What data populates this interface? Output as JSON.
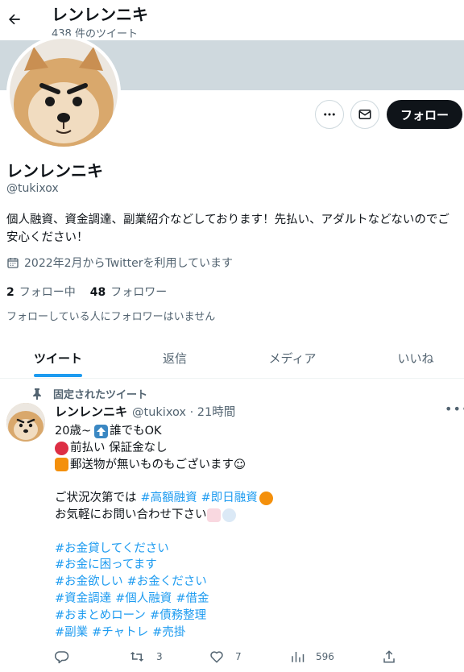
{
  "header": {
    "title": "レンレンニキ",
    "tweet_count": "438 件のツイート"
  },
  "profile": {
    "name": "レンレンニキ",
    "handle": "@tukixox",
    "bio": "個人融資、資金調達、副業紹介などしております！先払い、アダルトなどないのでご安心ください！",
    "joined": "2022年2月からTwitterを利用しています",
    "following_count": "2",
    "following_label": "フォロー中",
    "followers_count": "48",
    "followers_label": "フォロワー",
    "no_known_followers": "フォローしている人にフォロワーはいません",
    "follow_button": "フォロー"
  },
  "tabs": [
    "ツイート",
    "返信",
    "メディア",
    "いいね"
  ],
  "tweet": {
    "pinned_label": "固定されたツイート",
    "name": "レンレンニキ",
    "meta": "@tukixox · 21時間",
    "line1_a": "20歳~",
    "line1_b": "誰でもOK",
    "line2": "前払い 保証金なし",
    "line3": "郵送物が無いものもございます☺",
    "line5_a": "ご状況次第では",
    "line5_h1": "#高額融資",
    "line5_h2": "#即日融資",
    "line6": "お気軽にお問い合わせ下さい",
    "hashtags": [
      [
        "#お金貸してください"
      ],
      [
        "#お金に困ってます"
      ],
      [
        "#お金欲しい",
        "#お金ください"
      ],
      [
        "#資金調達",
        "#個人融資",
        "#借金"
      ],
      [
        "#おまとめローン",
        "#債務整理"
      ],
      [
        "#副業",
        "#チャトレ",
        "#売掛"
      ]
    ],
    "replies": "",
    "retweets": "3",
    "likes": "7",
    "views": "596"
  },
  "colors": {
    "accent": "#1d9bf0",
    "banner": "#cfd9de",
    "muted": "#536471",
    "text": "#0f1419"
  }
}
